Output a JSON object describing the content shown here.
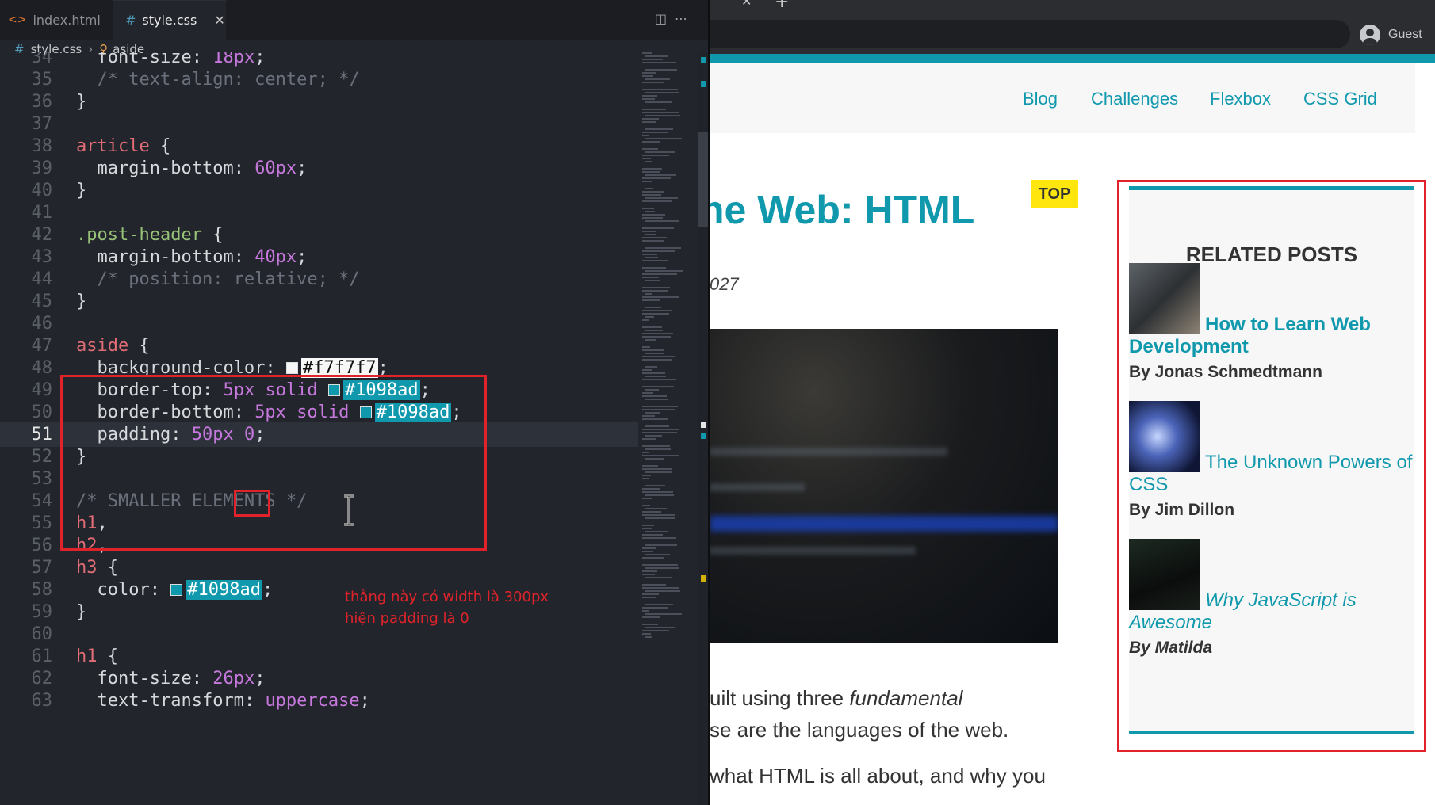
{
  "editor": {
    "tabs": [
      {
        "label": "index.html",
        "icon": "html-file-icon"
      },
      {
        "label": "style.css",
        "icon": "css-file-icon"
      }
    ],
    "breadcrumb": {
      "file": "style.css",
      "symbol": "aside"
    },
    "annotation": [
      "thằng này có width là 300px",
      "hiện padding là 0"
    ]
  },
  "browser": {
    "profile": "Guest",
    "nav": [
      "Blog",
      "Challenges",
      "Flexbox",
      "CSS Grid"
    ],
    "post_title": "he Web: HTML",
    "badge": "TOP",
    "date": "027",
    "paragraphs": [
      {
        "before": "uilt using three ",
        "em": "fundamental",
        "after": ""
      },
      {
        "before": "se are the languages of the web.",
        "em": "",
        "after": ""
      },
      {
        "before": "what HTML is all about, and why you",
        "em": "",
        "after": ""
      }
    ],
    "aside": {
      "heading": "RELATED POSTS",
      "posts": [
        {
          "title": "How to Learn Web Development",
          "author": "By Jonas Schmedtmann"
        },
        {
          "title": "The Unknown Powers of CSS",
          "author": "By Jim Dillon"
        },
        {
          "title": "Why JavaScript is Awesome",
          "author": "By Matilda"
        }
      ]
    }
  },
  "colors": {
    "accent": "#1098ad",
    "aside_bg": "#f7f7f7",
    "highlight_box": "#e0232b",
    "badge": "#ffe70e"
  }
}
